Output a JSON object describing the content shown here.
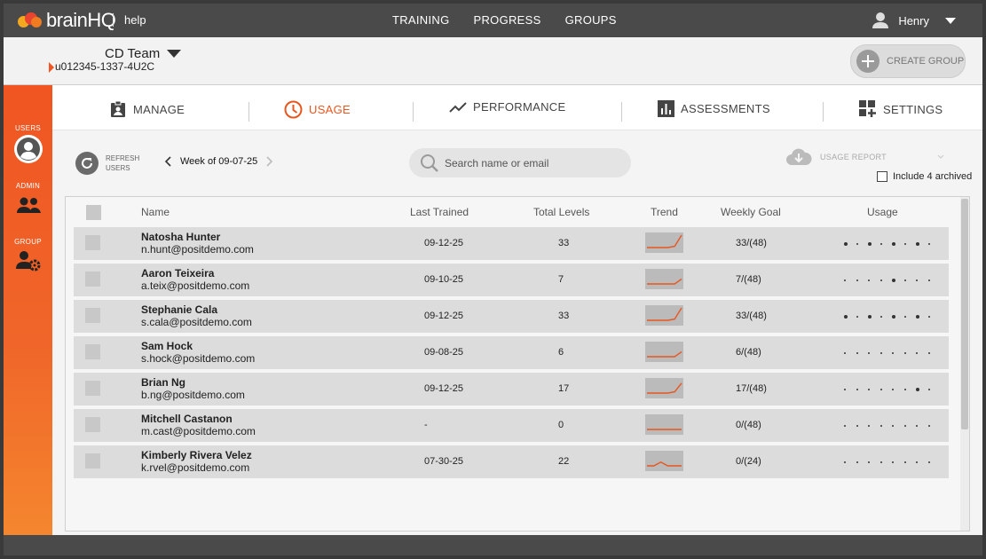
{
  "app": {
    "brand": "brainHQ",
    "help": "help"
  },
  "topnav": [
    "TRAINING",
    "PROGRESS",
    "GROUPS"
  ],
  "user": {
    "name": "Henry"
  },
  "team": {
    "name": "CD Team",
    "id": "u012345-1337-4U2C"
  },
  "create_group": "CREATE GROUP",
  "sidebar": [
    {
      "label": "USERS",
      "icon": "user-circle-icon",
      "active": true
    },
    {
      "label": "ADMIN",
      "icon": "admin-users-icon"
    },
    {
      "label": "GROUP",
      "icon": "group-settings-icon"
    }
  ],
  "tabs": [
    {
      "label": "MANAGE",
      "icon": "clipboard-icon"
    },
    {
      "label": "USAGE",
      "icon": "clock-icon",
      "active": true
    },
    {
      "label": "PERFORMANCE",
      "icon": "trend-line-icon"
    },
    {
      "label": "ASSESSMENTS",
      "icon": "bar-chart-icon"
    },
    {
      "label": "SETTINGS",
      "icon": "settings-grid-icon"
    }
  ],
  "toolbar": {
    "refresh_line1": "REFRESH",
    "refresh_line2": "USERS",
    "week": "Week of 09-07-25",
    "search_placeholder": "Search name or email",
    "usage_report": "USAGE REPORT",
    "archived": "Include 4 archived"
  },
  "table": {
    "headers": [
      "Name",
      "Last Trained",
      "Total Levels",
      "Trend",
      "Weekly Goal",
      "Usage"
    ],
    "rows": [
      {
        "name": "Natosha Hunter",
        "email": "n.hunt@positdemo.com",
        "last": "09-12-25",
        "levels": "33",
        "goal": "33/(48)",
        "trend": [
          0,
          0,
          0,
          0,
          0.1,
          1
        ],
        "usage": [
          1,
          0,
          1,
          0,
          1,
          0,
          1,
          0
        ]
      },
      {
        "name": "Aaron Teixeira",
        "email": "a.teix@positdemo.com",
        "last": "09-10-25",
        "levels": "7",
        "goal": "7/(48)",
        "trend": [
          0,
          0,
          0,
          0,
          0,
          0.4
        ],
        "usage": [
          0,
          0,
          0,
          0,
          1,
          0,
          0,
          0
        ]
      },
      {
        "name": "Stephanie Cala",
        "email": "s.cala@positdemo.com",
        "last": "09-12-25",
        "levels": "33",
        "goal": "33/(48)",
        "trend": [
          0,
          0,
          0,
          0,
          0.1,
          1
        ],
        "usage": [
          1,
          0,
          1,
          0,
          1,
          0,
          1,
          0
        ]
      },
      {
        "name": "Sam Hock",
        "email": "s.hock@positdemo.com",
        "last": "09-08-25",
        "levels": "6",
        "goal": "6/(48)",
        "trend": [
          0,
          0,
          0,
          0,
          0,
          0.4
        ],
        "usage": [
          0,
          0,
          0,
          0,
          0,
          0,
          0,
          0
        ]
      },
      {
        "name": "Brian Ng",
        "email": "b.ng@positdemo.com",
        "last": "09-12-25",
        "levels": "17",
        "goal": "17/(48)",
        "trend": [
          0,
          0,
          0,
          0,
          0.1,
          0.8
        ],
        "usage": [
          0,
          0,
          0,
          0,
          0,
          0,
          1,
          0
        ]
      },
      {
        "name": "Mitchell Castanon",
        "email": "m.cast@positdemo.com",
        "last": "-",
        "levels": "0",
        "goal": "0/(48)",
        "trend": [
          0,
          0,
          0,
          0,
          0,
          0
        ],
        "usage": [
          0,
          0,
          0,
          0,
          0,
          0,
          0,
          0
        ]
      },
      {
        "name": "Kimberly Rivera Velez",
        "email": "k.rvel@positdemo.com",
        "last": "07-30-25",
        "levels": "22",
        "goal": "0/(24)",
        "trend": [
          0,
          0,
          0.3,
          0,
          0,
          0
        ],
        "usage": [
          0,
          0,
          0,
          0,
          0,
          0,
          0,
          0
        ]
      }
    ]
  },
  "colors": {
    "accent": "#e8561f",
    "trend_line": "#e8561f",
    "sidebar": "#f05522"
  }
}
